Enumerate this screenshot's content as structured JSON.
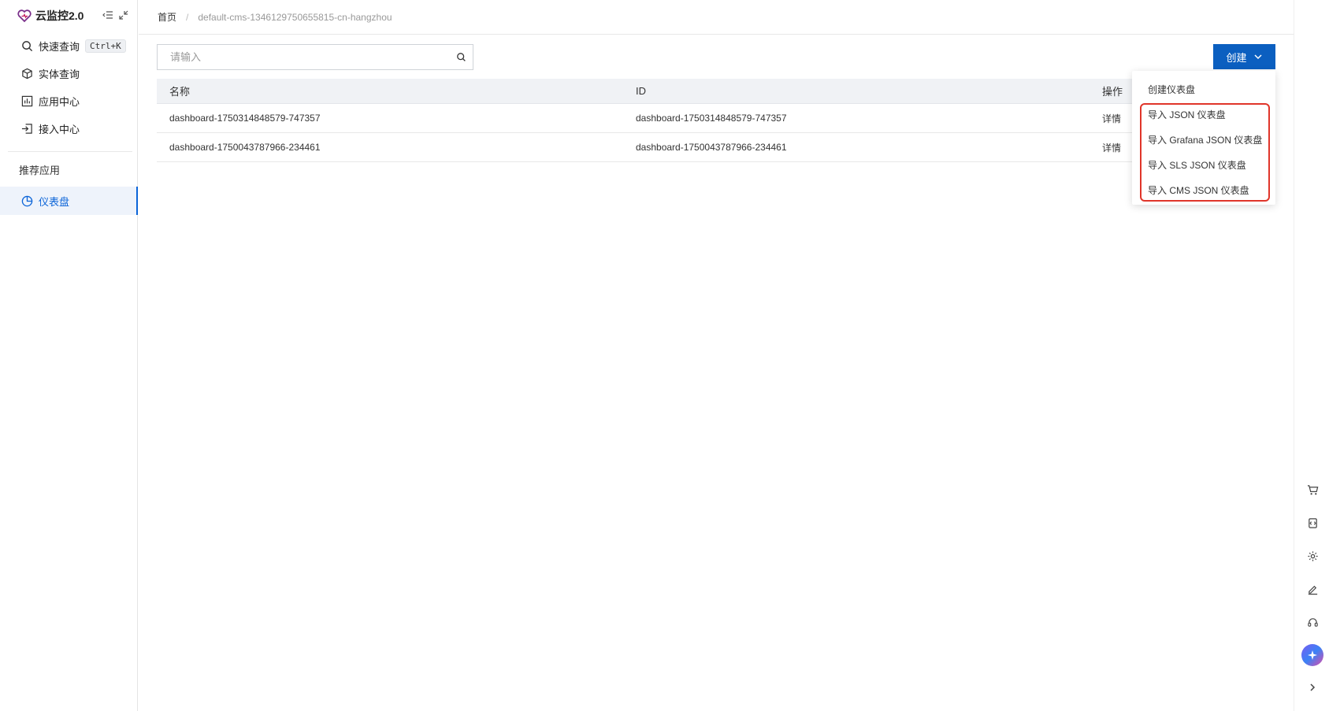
{
  "sidebar": {
    "brand": "云监控2.0",
    "items": [
      {
        "label": "快速查询",
        "shortcut": "Ctrl+K",
        "icon": "search-icon"
      },
      {
        "label": "实体查询",
        "icon": "cube-icon"
      },
      {
        "label": "应用中心",
        "icon": "chart-box-icon"
      },
      {
        "label": "接入中心",
        "icon": "import-icon"
      }
    ],
    "group_label": "推荐应用",
    "active_item": {
      "label": "仪表盘",
      "icon": "pie-chart-icon"
    }
  },
  "header": {
    "breadcrumb_home": "首页",
    "breadcrumb_sep": "/",
    "breadcrumb_current": "default-cms-1346129750655815-cn-hangzhou"
  },
  "search": {
    "placeholder": "请输入"
  },
  "toolbar": {
    "create_label": "创建"
  },
  "table": {
    "columns": [
      "名称",
      "ID",
      "操作"
    ],
    "rows": [
      {
        "name": "dashboard-1750314848579-747357",
        "id": "dashboard-1750314848579-747357",
        "action": "详情"
      },
      {
        "name": "dashboard-1750043787966-234461",
        "id": "dashboard-1750043787966-234461",
        "action": "详情"
      }
    ]
  },
  "dropdown": {
    "items": [
      "创建仪表盘",
      "导入 JSON 仪表盘",
      "导入 Grafana JSON 仪表盘",
      "导入 SLS JSON 仪表盘",
      "导入 CMS JSON 仪表盘"
    ]
  },
  "colors": {
    "accent": "#0b5fc0",
    "link": "#0b64d8",
    "highlight": "#e0352a"
  },
  "right_rail": {
    "icons": [
      "cart-icon",
      "api-icon",
      "gear-icon",
      "edit-icon",
      "headset-icon",
      "ai-assistant-icon",
      "chevron-right-icon"
    ]
  }
}
